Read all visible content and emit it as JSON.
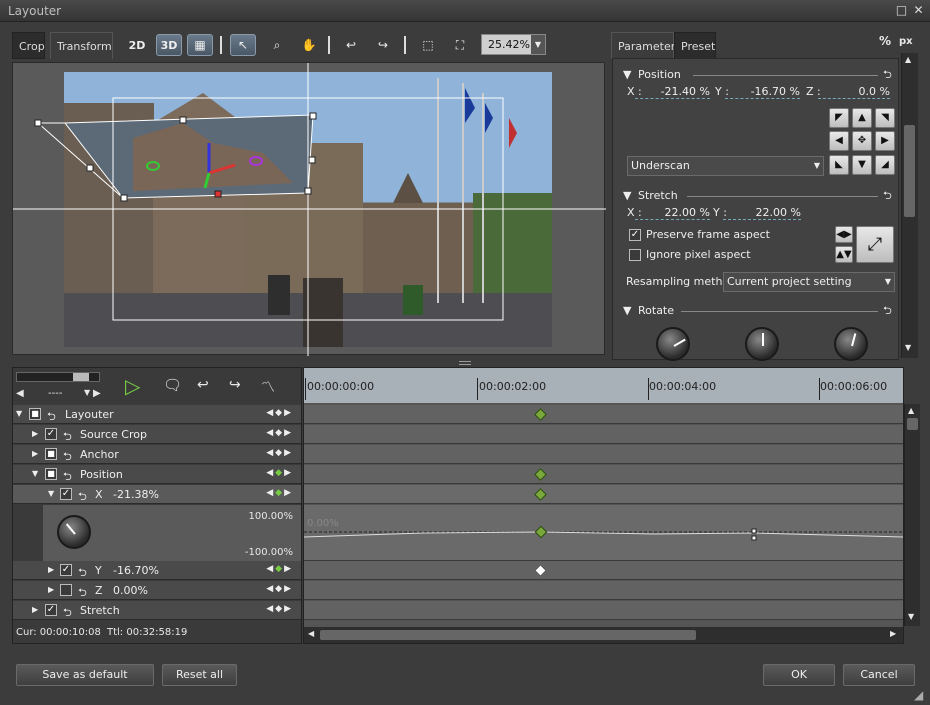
{
  "window": {
    "title": "Layouter"
  },
  "left_tabs": [
    "Crop",
    "Transform"
  ],
  "toolbar": {
    "mode_2d": "2D",
    "mode_3d": "3D",
    "zoom": "25.42%"
  },
  "right_tabs": [
    "Parameter",
    "Preset"
  ],
  "units": {
    "percent": "%",
    "pixel": "px"
  },
  "position": {
    "header": "Position",
    "x_label": "X :",
    "x_value": "-21.40 %",
    "y_label": "Y :",
    "y_value": "-16.70 %",
    "z_label": "Z :",
    "z_value": "0.0 %",
    "underscan": "Underscan"
  },
  "stretch": {
    "header": "Stretch",
    "x_label": "X :",
    "x_value": "22.00 %",
    "y_label": "Y :",
    "y_value": "22.00 %",
    "preserve": "Preserve frame aspect",
    "ignore": "Ignore pixel aspect",
    "resampling_label": "Resampling method",
    "resampling_value": "Current project setting"
  },
  "rotate": {
    "header": "Rotate"
  },
  "timeline": {
    "ruler": [
      "00:00:00:00",
      "00:00:02:00",
      "00:00:04:00",
      "00:00:06:00"
    ],
    "status_cur": "Cur: 00:00:10:08",
    "status_ttl": "Ttl: 00:32:58:19",
    "dropdown": "----",
    "tracks": {
      "layouter": "Layouter",
      "source_crop": "Source Crop",
      "anchor": "Anchor",
      "position": "Position",
      "x": "X",
      "x_val": "-21.38%",
      "graph_top": "100.00%",
      "graph_bottom": "-100.00%",
      "graph_zero": "0.00%",
      "y": "Y",
      "y_val": "-16.70%",
      "z": "Z",
      "z_val": "0.00%",
      "stretch": "Stretch"
    }
  },
  "buttons": {
    "save_default": "Save as default",
    "reset_all": "Reset all",
    "ok": "OK",
    "cancel": "Cancel"
  }
}
